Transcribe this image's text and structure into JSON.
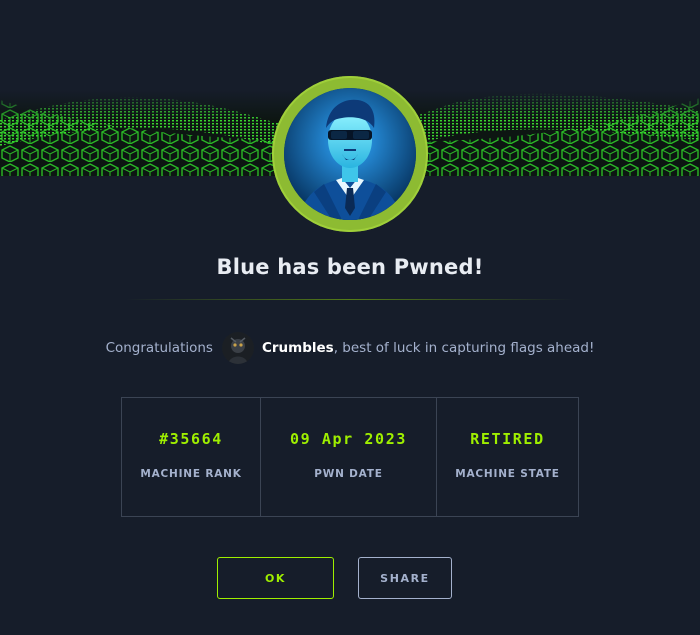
{
  "dialog": {
    "title": "Blue has been Pwned!",
    "congrats_prefix": "Congratulations",
    "username": "Crumbles",
    "congrats_suffix": ", best of luck in capturing flags ahead!"
  },
  "stats": [
    {
      "value": "#35664",
      "label": "MACHINE RANK"
    },
    {
      "value": "09 Apr 2023",
      "label": "PWN DATE"
    },
    {
      "value": "RETIRED",
      "label": "MACHINE STATE"
    }
  ],
  "buttons": {
    "ok_label": "OK",
    "share_label": "SHARE"
  },
  "colors": {
    "accent": "#9fef00",
    "background": "#161d2a",
    "muted_text": "#a4b1cd",
    "ring": "#8dbb32"
  }
}
